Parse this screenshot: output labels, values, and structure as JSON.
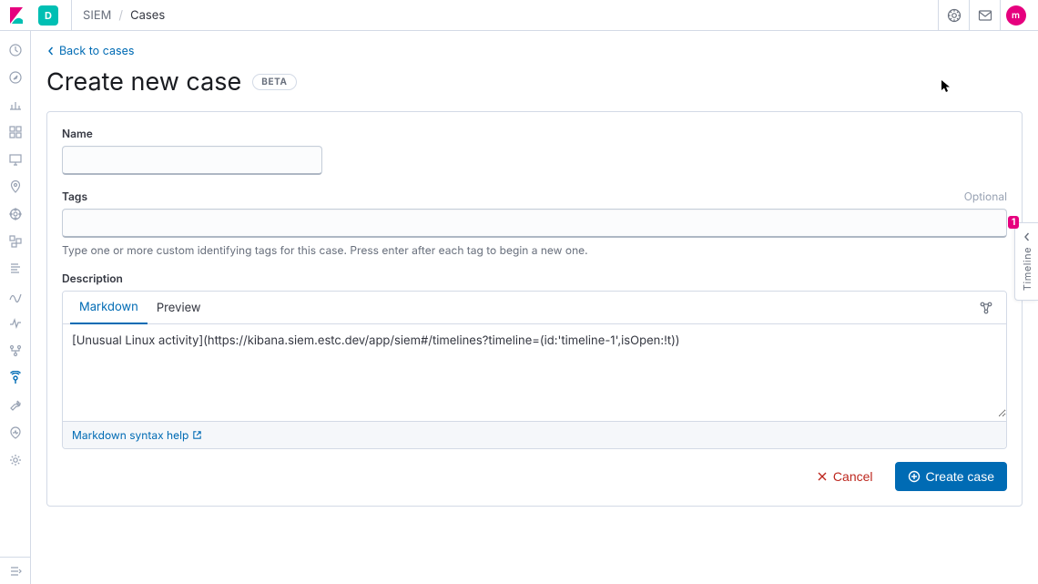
{
  "header": {
    "space_initial": "D",
    "breadcrumb_app": "SIEM",
    "breadcrumb_page": "Cases",
    "user_initial": "m"
  },
  "page": {
    "back_label": "Back to cases",
    "title": "Create new case",
    "beta_label": "BETA"
  },
  "form": {
    "name_label": "Name",
    "name_value": "",
    "tags_label": "Tags",
    "tags_optional": "Optional",
    "tags_value": "",
    "tags_help": "Type one or more custom identifying tags for this case. Press enter after each tag to begin a new one.",
    "description_label": "Description",
    "tabs": {
      "markdown": "Markdown",
      "preview": "Preview"
    },
    "description_value": "[Unusual Linux activity](https://kibana.siem.estc.dev/app/siem#/timelines?timeline=(id:'timeline-1',isOpen:!t))",
    "md_help": "Markdown syntax help"
  },
  "actions": {
    "cancel": "Cancel",
    "submit": "Create case"
  },
  "timeline": {
    "label": "Timeline",
    "badge": "1"
  }
}
